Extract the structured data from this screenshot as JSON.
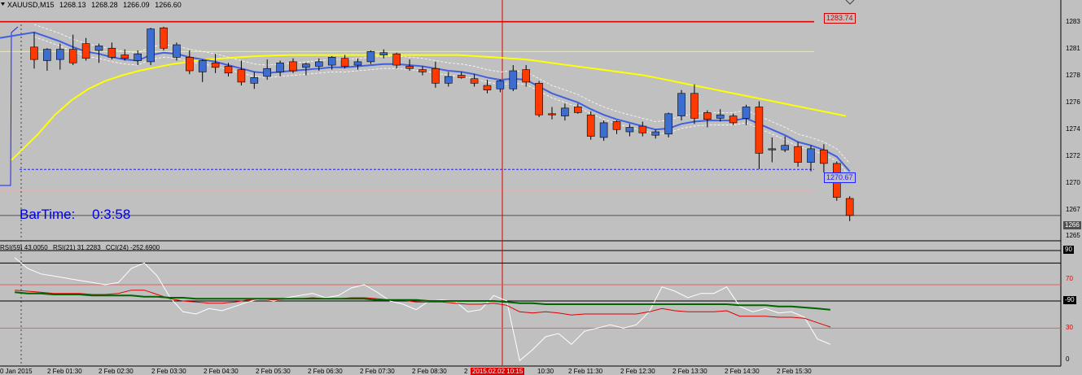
{
  "chart_header": {
    "symbol": "XAUUSD,M15",
    "ohlc": [
      "1268.13",
      "1268.28",
      "1266.09",
      "1266.60"
    ]
  },
  "bartime": {
    "label": "BarTime:",
    "value": "0:3:58"
  },
  "price_tags": {
    "resistance": "1283.74",
    "level": "1270.67",
    "current": "1266"
  },
  "price_axis": [
    "1283",
    "1281",
    "1278",
    "1276",
    "1274",
    "1272",
    "1270",
    "1267",
    "1265"
  ],
  "indicator_header": [
    "RSI(59) 43.0050",
    "RSI(21) 31.2283",
    "CCI(24) -252.6900"
  ],
  "indicator_axis": [
    "90",
    "70",
    "-90",
    "30",
    "0"
  ],
  "time_axis": {
    "labels": [
      "0 Jan 2015",
      "2 Feb 01:30",
      "2 Feb 02:30",
      "2 Feb 03:30",
      "2 Feb 04:30",
      "2 Feb 05:30",
      "2 Feb 06:30",
      "2 Feb 07:30",
      "2 Feb 08:30",
      "2",
      "10:30",
      "2 Feb 11:30",
      "2 Feb 12:30",
      "2 Feb 13:30",
      "2 Feb 14:30",
      "2 Feb 15:30"
    ],
    "crosshair": "2015.02.02 10:15"
  },
  "chart_data": {
    "type": "candlestick",
    "symbol": "XAUUSD",
    "timeframe": "M15",
    "y_range": [
      1264.5,
      1284.8
    ],
    "candles": [
      [
        1281.5,
        1282.8,
        1279.6,
        1280.4
      ],
      [
        1280.3,
        1281.4,
        1279.4,
        1281.3
      ],
      [
        1280.4,
        1281.8,
        1279.5,
        1281.3
      ],
      [
        1281.3,
        1282.6,
        1279.9,
        1280.1
      ],
      [
        1281.8,
        1282.3,
        1280.3,
        1280.5
      ],
      [
        1281.2,
        1281.8,
        1280.1,
        1281.6
      ],
      [
        1281.4,
        1281.9,
        1280.4,
        1280.6
      ],
      [
        1280.8,
        1281.3,
        1280.3,
        1280.5
      ],
      [
        1280.3,
        1281.2,
        1279.9,
        1280.9
      ],
      [
        1280.2,
        1283.2,
        1279.9,
        1283.1
      ],
      [
        1283.2,
        1283.3,
        1281.2,
        1281.4
      ],
      [
        1280.6,
        1281.9,
        1280.3,
        1281.7
      ],
      [
        1280.6,
        1281.2,
        1279.1,
        1279.4
      ],
      [
        1279.3,
        1280.4,
        1278.4,
        1280.3
      ],
      [
        1280.1,
        1280.9,
        1279.2,
        1279.7
      ],
      [
        1279.8,
        1280.1,
        1278.9,
        1279.2
      ],
      [
        1279.5,
        1280.3,
        1278.1,
        1278.4
      ],
      [
        1278.3,
        1279.3,
        1277.8,
        1278.8
      ],
      [
        1278.9,
        1280.4,
        1278.6,
        1279.6
      ],
      [
        1279.3,
        1280.3,
        1278.9,
        1280.1
      ],
      [
        1280.2,
        1280.5,
        1279.2,
        1279.4
      ],
      [
        1279.7,
        1280.1,
        1279.0,
        1280.0
      ],
      [
        1279.8,
        1280.5,
        1279.4,
        1280.2
      ],
      [
        1279.9,
        1280.7,
        1279.5,
        1280.6
      ],
      [
        1280.5,
        1280.8,
        1279.6,
        1279.8
      ],
      [
        1279.9,
        1280.5,
        1279.5,
        1280.2
      ],
      [
        1280.2,
        1281.2,
        1280.0,
        1281.1
      ],
      [
        1280.8,
        1281.3,
        1280.5,
        1281.0
      ],
      [
        1280.9,
        1281.0,
        1279.6,
        1279.9
      ],
      [
        1279.8,
        1280.4,
        1279.4,
        1279.6
      ],
      [
        1279.5,
        1279.8,
        1279.0,
        1279.3
      ],
      [
        1279.6,
        1280.2,
        1277.9,
        1278.3
      ],
      [
        1278.3,
        1279.3,
        1278.0,
        1278.9
      ],
      [
        1279.0,
        1279.3,
        1278.7,
        1278.8
      ],
      [
        1278.7,
        1279.1,
        1278.0,
        1278.3
      ],
      [
        1278.1,
        1278.6,
        1277.4,
        1277.7
      ],
      [
        1277.8,
        1278.6,
        1277.5,
        1278.5
      ],
      [
        1277.8,
        1279.9,
        1277.6,
        1279.4
      ],
      [
        1279.5,
        1279.9,
        1278.0,
        1278.4
      ],
      [
        1278.3,
        1278.5,
        1275.3,
        1275.5
      ],
      [
        1275.6,
        1276.2,
        1275.1,
        1275.5
      ],
      [
        1275.4,
        1276.5,
        1275.0,
        1276.1
      ],
      [
        1276.2,
        1276.5,
        1275.6,
        1275.7
      ],
      [
        1275.5,
        1275.8,
        1273.3,
        1273.6
      ],
      [
        1273.5,
        1275.0,
        1273.2,
        1274.8
      ],
      [
        1274.9,
        1275.0,
        1273.8,
        1274.2
      ],
      [
        1274.0,
        1274.7,
        1273.6,
        1274.4
      ],
      [
        1274.5,
        1274.9,
        1273.6,
        1273.9
      ],
      [
        1273.7,
        1274.2,
        1273.4,
        1274.0
      ],
      [
        1273.8,
        1275.7,
        1273.5,
        1275.6
      ],
      [
        1275.4,
        1277.7,
        1275.0,
        1277.4
      ],
      [
        1277.4,
        1278.2,
        1274.7,
        1275.2
      ],
      [
        1275.7,
        1275.9,
        1274.4,
        1275.1
      ],
      [
        1275.2,
        1276.0,
        1274.9,
        1275.5
      ],
      [
        1275.4,
        1275.6,
        1274.6,
        1274.8
      ],
      [
        1275.2,
        1276.4,
        1274.6,
        1276.2
      ],
      [
        1276.2,
        1276.7,
        1270.7,
        1272.1
      ],
      [
        1272.4,
        1273.5,
        1271.3,
        1272.5
      ],
      [
        1272.4,
        1273.6,
        1272.2,
        1272.8
      ],
      [
        1272.7,
        1273.1,
        1270.9,
        1271.3
      ],
      [
        1271.3,
        1272.8,
        1270.5,
        1272.5
      ],
      [
        1272.4,
        1272.9,
        1270.4,
        1271.2
      ],
      [
        1271.2,
        1271.4,
        1267.9,
        1268.2
      ],
      [
        1268.1,
        1268.3,
        1266.1,
        1266.6
      ]
    ],
    "overlay_lines": [
      {
        "name": "",
        "color": "#ffff00",
        "values": [
          1271.5,
          1273.8,
          1275.5,
          1276.8,
          1277.8,
          1278.5,
          1279.0,
          1279.4,
          1279.7,
          1280.0,
          1280.2,
          1280.4,
          1280.5,
          1280.6,
          1280.7,
          1280.75,
          1280.8,
          1280.8,
          1280.8,
          1280.8,
          1280.8,
          1280.8,
          1280.8,
          1280.8,
          1280.8,
          1280.8,
          1280.8,
          1280.7,
          1280.6,
          1280.5,
          1280.4,
          1280.2,
          1280.0,
          1279.8,
          1279.6,
          1279.4,
          1279.2,
          1279.0,
          1278.7,
          1278.4,
          1278.1,
          1277.8,
          1277.5,
          1277.2,
          1276.9,
          1276.6,
          1276.3,
          1276.0,
          1275.7,
          1275.4
        ]
      },
      {
        "name": "",
        "color": "#4060e0",
        "values": [
          1282.8,
          1282.4,
          1282.0,
          1281.5,
          1281.1,
          1280.9,
          1280.6,
          1280.4,
          1280.3,
          1280.8,
          1281.0,
          1280.9,
          1280.6,
          1280.4,
          1280.2,
          1279.9,
          1279.6,
          1279.3,
          1279.2,
          1279.3,
          1279.4,
          1279.5,
          1279.6,
          1279.7,
          1279.7,
          1279.8,
          1279.9,
          1280.0,
          1280.0,
          1279.9,
          1279.8,
          1279.6,
          1279.4,
          1279.3,
          1279.1,
          1278.8,
          1278.6,
          1278.7,
          1278.6,
          1278.0,
          1277.4,
          1277.0,
          1276.6,
          1276.0,
          1275.5,
          1275.1,
          1274.8,
          1274.5,
          1274.2,
          1274.3,
          1274.7,
          1274.9,
          1275.0,
          1275.0,
          1275.0,
          1275.2,
          1274.7,
          1274.2,
          1273.7,
          1273.1,
          1272.8,
          1272.4,
          1271.8,
          1270.5
        ]
      }
    ],
    "horizontal_lines": [
      {
        "value": 1283.74,
        "color": "#e00000",
        "style": "solid"
      },
      {
        "value": 1281.1,
        "color": "#ffff00",
        "style": "solid"
      },
      {
        "value": 1270.67,
        "color": "#2020ff",
        "style": "dashed"
      },
      {
        "value": 1268.8,
        "color": "#e8b0b0",
        "style": "solid"
      },
      {
        "value": 1266.6,
        "color": "#505050",
        "style": "solid"
      }
    ],
    "indicators": {
      "y_range": [
        -5,
        100
      ],
      "levels": [
        90,
        70,
        30
      ],
      "rsi_long_values": [
        63,
        62,
        62,
        61,
        61,
        61,
        60,
        60,
        60,
        60,
        59,
        59,
        58,
        58,
        57,
        57,
        57,
        57,
        57,
        57,
        57,
        57,
        57,
        57,
        57,
        57,
        57,
        57,
        56,
        56,
        56,
        56,
        55,
        55,
        55,
        55,
        55,
        55,
        54,
        53,
        53,
        52,
        52,
        52,
        52,
        52,
        52,
        52,
        52,
        52,
        52,
        52,
        52,
        52,
        52,
        52,
        51,
        51,
        51,
        50,
        50,
        49,
        48,
        47
      ],
      "rsi_short_values": [
        65,
        64,
        63,
        62,
        62,
        62,
        61,
        61,
        62,
        65,
        65,
        61,
        57,
        55,
        54,
        53,
        53,
        54,
        56,
        57,
        56,
        57,
        57,
        58,
        57,
        57,
        58,
        58,
        57,
        56,
        56,
        54,
        54,
        54,
        53,
        52,
        52,
        53,
        51,
        45,
        44,
        45,
        44,
        42,
        43,
        43,
        43,
        43,
        43,
        45,
        48,
        46,
        45,
        45,
        45,
        46,
        41,
        41,
        41,
        40,
        40,
        39,
        35,
        31
      ],
      "cci_values": [
        95,
        85,
        80,
        78,
        76,
        74,
        72,
        70,
        72,
        85,
        90,
        78,
        58,
        45,
        43,
        48,
        46,
        50,
        54,
        57,
        55,
        58,
        60,
        62,
        58,
        60,
        67,
        70,
        63,
        55,
        52,
        47,
        55,
        56,
        55,
        45,
        47,
        60,
        55,
        0,
        10,
        22,
        25,
        15,
        27,
        30,
        33,
        30,
        33,
        45,
        68,
        64,
        58,
        62,
        62,
        68,
        50,
        45,
        48,
        44,
        45,
        40,
        20,
        15
      ]
    }
  }
}
